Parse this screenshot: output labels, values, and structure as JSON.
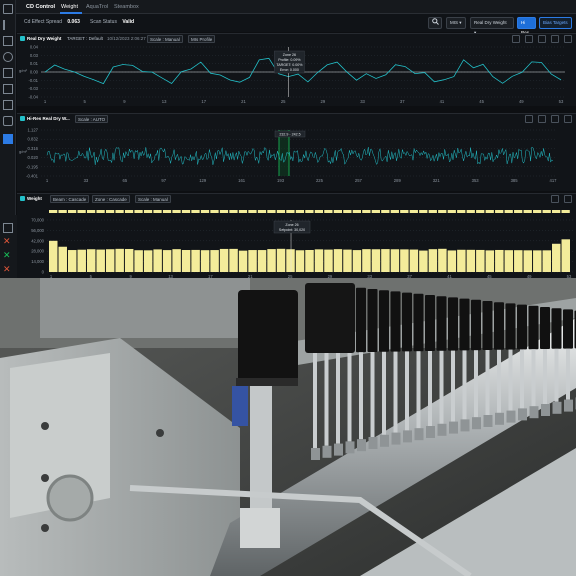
{
  "tabs": [
    "CD Control",
    "Weight",
    "AquaTrol",
    "Steambox"
  ],
  "toolbar": {
    "effect_spread_label": "Cd Effect Spread",
    "effect_spread_value": "0.063",
    "scan_status_label": "Scan Status",
    "scan_status_value": "Valid",
    "select_mis": "MIS",
    "select_weight": "Real Dry Weight",
    "hi_res_label": "Hi Res",
    "bias_targets_label": "Bias Targets"
  },
  "panel1": {
    "title": "Real Dry Weight",
    "target_chip": "TARGET : Default",
    "timestamp": "10/12/2023 2:06:27 PM",
    "scale_chip": "Scale : Manual",
    "mis_chip": "MIs Profile",
    "tooltip": [
      "Zone 26",
      "Profile: 0.09%",
      "TARGET: 0.00%",
      "Error: 0.000"
    ],
    "ylabel": "g/m²",
    "yticks": [
      "0.04",
      "0.03",
      "0.01",
      "0.00",
      "-0.01",
      "-0.03",
      "-0.04"
    ],
    "xticks": [
      "1",
      "5",
      "9",
      "13",
      "17",
      "21",
      "25",
      "29",
      "33",
      "37",
      "41",
      "45",
      "49",
      "53"
    ]
  },
  "panel2": {
    "title": "Hi-Res Real Dry W...",
    "scale_chip": "Scale : AUTO",
    "tooltip": "232.9 - 242.5",
    "ylabel": "g/m²",
    "yticks": [
      "1.127",
      "0.832",
      "0.316",
      "0.020",
      "-0.195",
      "-0.401"
    ],
    "xticks": [
      "1",
      "33",
      "65",
      "97",
      "129",
      "161",
      "193",
      "225",
      "257",
      "289",
      "321",
      "353",
      "385",
      "417"
    ]
  },
  "panel3": {
    "title": "Weight",
    "beam_chip": "Beam : Cascade",
    "zone_chip": "Zone : Cascade",
    "scale_chip": "Scale : Manual",
    "tooltip": [
      "Zone 26",
      "Setpoint: 30,020"
    ],
    "yticks": [
      "70,000",
      "56,000",
      "42,000",
      "28,000",
      "14,000",
      "0"
    ],
    "xticks": [
      "1",
      "5",
      "9",
      "13",
      "17",
      "21",
      "25",
      "29",
      "33",
      "37",
      "41",
      "45",
      "49",
      "53"
    ]
  },
  "colors": {
    "accent_cyan": "#23c0c9",
    "bar_yellow": "#f3ec9a",
    "hi_res_green": "#19c35a",
    "button_blue": "#1e6fd9"
  }
}
